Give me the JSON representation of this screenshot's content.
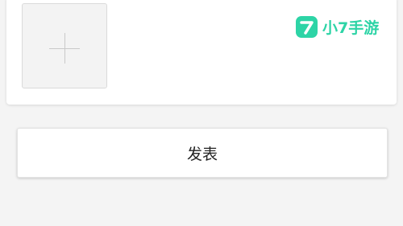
{
  "image_picker": {
    "icon": "plus-icon"
  },
  "watermark": {
    "logo_icon": "7-logo-icon",
    "text": "小7手游",
    "color": "#2dd4a6"
  },
  "actions": {
    "publish_label": "发表"
  }
}
